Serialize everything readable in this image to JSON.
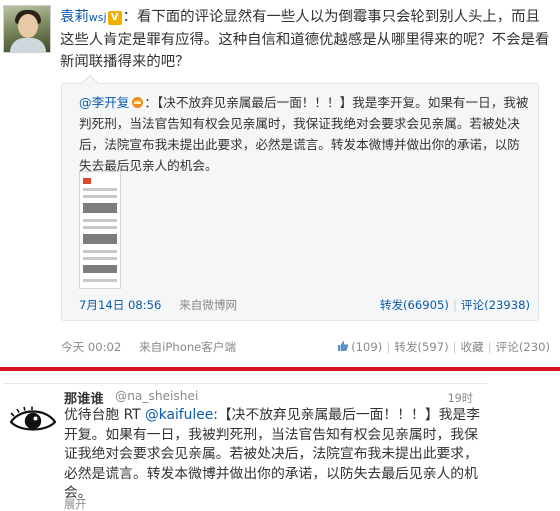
{
  "post1": {
    "author": "袁莉",
    "author_tag": "wsj",
    "verified_badge": "V",
    "separator": "：",
    "text": "看下面的评论显然有一些人以为倒霉事只会轮到别人头上，而且这些人肯定是罪有应得。这种自信和道德优越感是从哪里得来的呢？不会是看新闻联播得来的吧？",
    "quote": {
      "user": "@李开复",
      "text": "：【决不放弃见亲属最后一面！！！】我是李开复。如果有一日，我被判死刑，当法官告知有权会见亲属时，我保证我绝对会要求会见亲属。若被处决后，法院宣布我未提出此要求，必然是谎言。转发本微博并做出你的承诺，以防失去最后见亲人的机会。",
      "time": "7月14日 08:56",
      "source": "来自微博网",
      "repost_label": "转发(66905)",
      "comment_label": "评论(23938)",
      "sep": "|"
    },
    "time": "今天 00:02",
    "source": "来自iPhone客户端",
    "like_label": "(109)",
    "repost_label": "转发(597)",
    "fav_label": "收藏",
    "comment_label": "评论(230)",
    "sep": "|"
  },
  "post2": {
    "name": "那谁谁",
    "handle": "@na_sheishei",
    "time": "19时",
    "text_prefix": "优待台胞 RT ",
    "mention": "@kaifulee",
    "text_body": ":【决不放弃见亲属最后一面！！！】我是李开复。如果有一日，我被判死刑，当法官告知有权会见亲属时，我保证我绝对会要求会见亲属。若被处决后，法院宣布我未提出此要求，必然是谎言。转发本微博并做出你的承诺，以防失去最后见亲人的机会。",
    "expand_label": "展开"
  },
  "colors": {
    "link": "#0a5aa8",
    "divider": "#d5151d",
    "quote_bg": "#f4f6f8",
    "meta": "#8a8a8a"
  },
  "icons": [
    "avatar-photo",
    "verified-v-icon",
    "crown-icon",
    "thumbs-up-icon",
    "eye-icon"
  ]
}
